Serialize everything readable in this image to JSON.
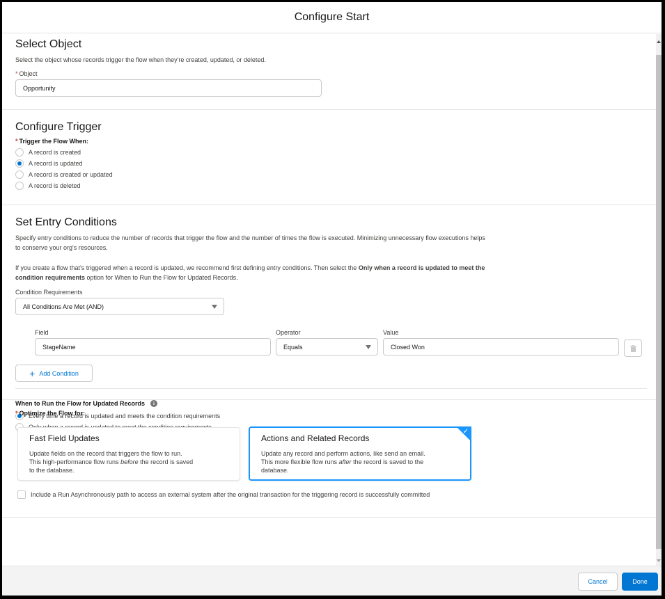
{
  "modal": {
    "title": "Configure Start"
  },
  "select_object": {
    "heading": "Select Object",
    "description": "Select the object whose records trigger the flow when they're created, updated, or deleted.",
    "object_label": "Object",
    "object_value": "Opportunity"
  },
  "configure_trigger": {
    "heading": "Configure Trigger",
    "label": "Trigger the Flow When:",
    "options": [
      {
        "label": "A record is created",
        "selected": false
      },
      {
        "label": "A record is updated",
        "selected": true
      },
      {
        "label": "A record is created or updated",
        "selected": false
      },
      {
        "label": "A record is deleted",
        "selected": false
      }
    ]
  },
  "entry_conditions": {
    "heading": "Set Entry Conditions",
    "description": "Specify entry conditions to reduce the number of records that trigger the flow and the number of times the flow is executed. Minimizing unnecessary flow executions helps to conserve your org's resources.",
    "note_prefix": "If you create a flow that's triggered when a record is updated, we recommend first defining entry conditions. Then select the ",
    "note_bold": "Only when a record is updated to meet the condition requirements",
    "note_suffix": " option for When to Run the Flow for Updated Records.",
    "requirements_label": "Condition Requirements",
    "requirements_value": "All Conditions Are Met (AND)",
    "field_label": "Field",
    "operator_label": "Operator",
    "value_label": "Value",
    "conditions": [
      {
        "field": "StageName",
        "operator": "Equals",
        "value": "Closed Won"
      }
    ],
    "add_condition_label": "Add Condition"
  },
  "when_to_run": {
    "label": "When to Run the Flow for Updated Records",
    "options": [
      {
        "label": "Every time a record is updated and meets the condition requirements",
        "selected": true
      },
      {
        "label": "Only when a record is updated to meet the condition requirements",
        "selected": false
      }
    ]
  },
  "optimize": {
    "label": "Optimize the Flow for:",
    "tiles": [
      {
        "title": "Fast Field Updates",
        "line1": "Update fields on the record that triggers the flow to run.",
        "line2_pre": "This high-performance flow runs ",
        "line2_em": "before",
        "line2_post": " the record is saved",
        "line3": "to the database.",
        "selected": false
      },
      {
        "title": "Actions and Related Records",
        "line1": "Update any record and perform actions, like send an email.",
        "line2_pre": "This more flexible flow runs ",
        "line2_em": "after",
        "line2_post": " the record is saved to the",
        "line3": "database.",
        "selected": true
      }
    ],
    "async_label": "Include a Run Asynchronously path to access an external system after the original transaction for the triggering record is successfully committed",
    "async_checked": false
  },
  "footer": {
    "cancel_label": "Cancel",
    "done_label": "Done"
  },
  "colors": {
    "brand": "#0176d3",
    "selected_border": "#1b96ff",
    "required": "#c23934"
  }
}
